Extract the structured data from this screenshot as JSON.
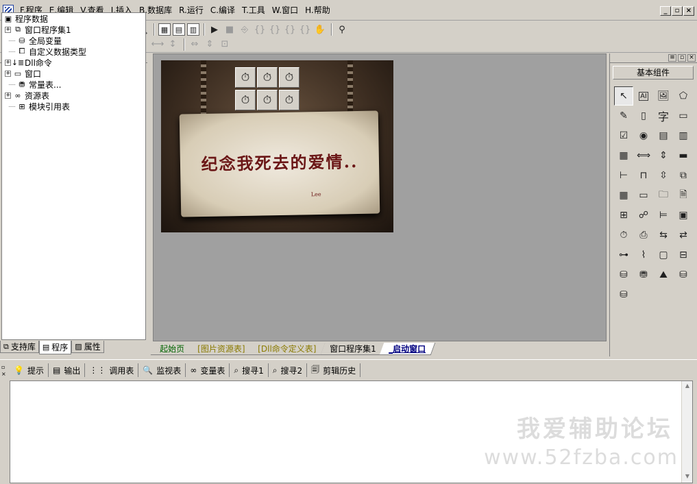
{
  "menu": {
    "items": [
      "F.程序",
      "E.编辑",
      "V.查看",
      "I.插入",
      "B.数据库",
      "R.运行",
      "C.编译",
      "T.工具",
      "W.窗口",
      "H.帮助"
    ]
  },
  "tree": {
    "items": [
      {
        "label": "程序数据",
        "icon": "program-data-icon"
      },
      {
        "label": "窗口程序集1",
        "icon": "assembly-icon"
      },
      {
        "label": "全局变量",
        "icon": "global-var-icon"
      },
      {
        "label": "自定义数据类型",
        "icon": "custom-type-icon"
      },
      {
        "label": "Dll命令",
        "icon": "dll-icon"
      },
      {
        "label": "窗口",
        "icon": "window-icon"
      },
      {
        "label": "常量表...",
        "icon": "constant-icon"
      },
      {
        "label": "资源表",
        "icon": "resource-icon"
      },
      {
        "label": "模块引用表",
        "icon": "module-icon"
      }
    ]
  },
  "left_tabs": [
    "支持库",
    "程序",
    "属性"
  ],
  "designer": {
    "sign_title": "纪念我死去的爱情..",
    "sign_author": "Lee"
  },
  "doc_tabs": [
    "起始页",
    "[图片资源表]",
    "[Dll命令定义表]",
    "窗口程序集1",
    "_启动窗口"
  ],
  "right_panel": {
    "title": "基本组件",
    "palette_text": {
      "label": "AI",
      "text": "字"
    }
  },
  "bottom_tabs": [
    "提示",
    "输出",
    "调用表",
    "监视表",
    "变量表",
    "搜寻1",
    "搜寻2",
    "剪辑历史"
  ],
  "watermark": {
    "line1": "我爱辅助论坛",
    "line2": "www.52fzba.com"
  }
}
